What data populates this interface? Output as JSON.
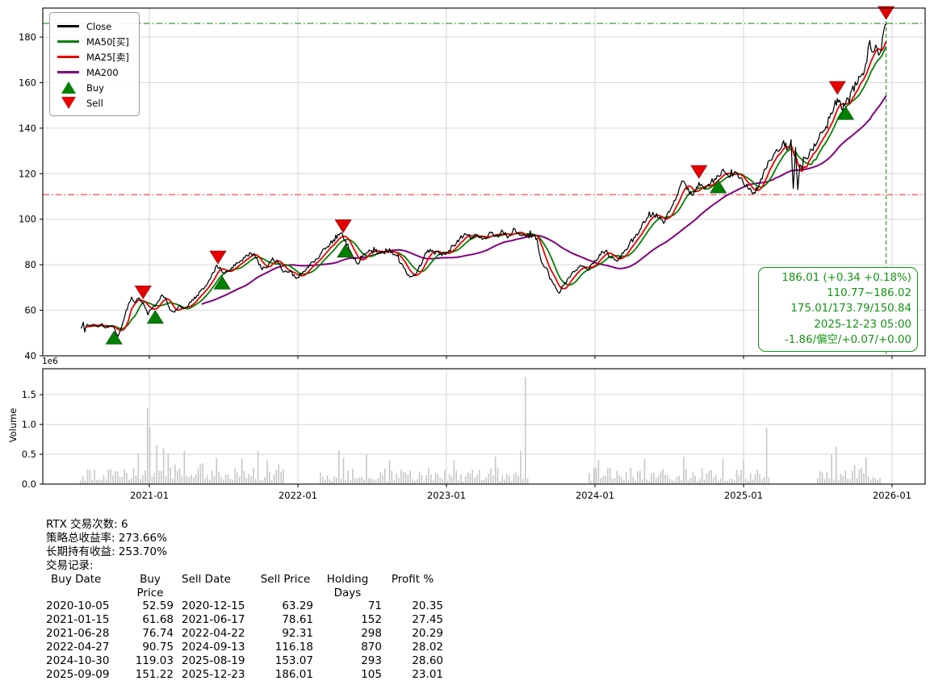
{
  "chart_data": {
    "type": "line",
    "seed": 1337,
    "x_axis": {
      "ticks": [
        2021,
        2022,
        2023,
        2024,
        2025,
        2026
      ],
      "tick_labels": [
        "2021-01",
        "2022-01",
        "2023-01",
        "2024-01",
        "2025-01",
        "2026-01"
      ]
    },
    "price_axis": {
      "ticks": [
        40,
        60,
        80,
        100,
        120,
        140,
        160,
        180
      ],
      "tick_labels": [
        "40",
        "60",
        "80",
        "100",
        "120",
        "140",
        "160",
        "180"
      ],
      "range": [
        40,
        192.8
      ]
    },
    "volume_axis": {
      "ticks": [
        0.0,
        0.5,
        1.0,
        1.5
      ],
      "tick_labels": [
        "0.0",
        "0.5",
        "1.0",
        "1.5"
      ],
      "scale_label": "1e6",
      "ylabel": "Volume",
      "range": [
        0,
        1.93
      ]
    },
    "legend": [
      {
        "label": "Close",
        "color": "#000000",
        "type": "line"
      },
      {
        "label": "MA50[买]",
        "color": "#008000",
        "type": "line"
      },
      {
        "label": "MA25[卖]",
        "color": "#e60000",
        "type": "line"
      },
      {
        "label": "MA200",
        "color": "#800080",
        "type": "line"
      },
      {
        "label": "Buy",
        "color": "#008000",
        "type": "triangle-up"
      },
      {
        "label": "Sell",
        "color": "#e60000",
        "type": "triangle-down"
      }
    ],
    "series": {
      "close": {
        "name": "Close",
        "color": "#000000",
        "anchors": [
          [
            2020.54,
            52.0
          ],
          [
            2020.555,
            54.8
          ],
          [
            2020.565,
            50.5
          ],
          [
            2020.58,
            53.8
          ],
          [
            2020.6,
            53.2
          ],
          [
            2020.625,
            53.8
          ],
          [
            2020.65,
            52.8
          ],
          [
            2020.68,
            54.2
          ],
          [
            2020.7,
            52.4
          ],
          [
            2020.73,
            53.0
          ],
          [
            2020.762,
            52.59
          ],
          [
            2020.79,
            48.6
          ],
          [
            2020.81,
            52.0
          ],
          [
            2020.835,
            57.5
          ],
          [
            2020.86,
            63.0
          ],
          [
            2020.88,
            65.8
          ],
          [
            2020.9,
            63.5
          ],
          [
            2020.93,
            65.5
          ],
          [
            2020.958,
            63.29
          ],
          [
            2020.99,
            58.0
          ],
          [
            2021.01,
            60.5
          ],
          [
            2021.04,
            61.68
          ],
          [
            2021.06,
            64.0
          ],
          [
            2021.085,
            66.8
          ],
          [
            2021.11,
            65.5
          ],
          [
            2021.14,
            60.0
          ],
          [
            2021.17,
            59.2
          ],
          [
            2021.2,
            62.0
          ],
          [
            2021.24,
            61.0
          ],
          [
            2021.28,
            63.5
          ],
          [
            2021.32,
            66.5
          ],
          [
            2021.36,
            69.5
          ],
          [
            2021.4,
            73.0
          ],
          [
            2021.43,
            76.5
          ],
          [
            2021.455,
            79.8
          ],
          [
            2021.462,
            78.61
          ],
          [
            2021.49,
            76.74
          ],
          [
            2021.53,
            77.5
          ],
          [
            2021.57,
            80.0
          ],
          [
            2021.61,
            81.5
          ],
          [
            2021.66,
            84.0
          ],
          [
            2021.7,
            84.8
          ],
          [
            2021.73,
            82.0
          ],
          [
            2021.76,
            77.8
          ],
          [
            2021.8,
            79.5
          ],
          [
            2021.83,
            83.0
          ],
          [
            2021.87,
            80.5
          ],
          [
            2021.91,
            77.0
          ],
          [
            2021.95,
            77.5
          ],
          [
            2021.99,
            74.0
          ],
          [
            2022.03,
            76.5
          ],
          [
            2022.08,
            80.0
          ],
          [
            2022.12,
            82.5
          ],
          [
            2022.16,
            85.5
          ],
          [
            2022.2,
            88.0
          ],
          [
            2022.24,
            91.0
          ],
          [
            2022.285,
            93.8
          ],
          [
            2022.305,
            92.31
          ],
          [
            2022.32,
            90.75
          ],
          [
            2022.36,
            85.0
          ],
          [
            2022.4,
            80.5
          ],
          [
            2022.44,
            84.5
          ],
          [
            2022.48,
            86.5
          ],
          [
            2022.52,
            86.0
          ],
          [
            2022.56,
            85.0
          ],
          [
            2022.6,
            86.5
          ],
          [
            2022.65,
            84.5
          ],
          [
            2022.69,
            80.5
          ],
          [
            2022.73,
            76.5
          ],
          [
            2022.77,
            74.8
          ],
          [
            2022.81,
            78.0
          ],
          [
            2022.85,
            83.5
          ],
          [
            2022.89,
            86.8
          ],
          [
            2022.93,
            86.0
          ],
          [
            2022.97,
            84.0
          ],
          [
            2023.01,
            85.5
          ],
          [
            2023.05,
            88.5
          ],
          [
            2023.09,
            91.5
          ],
          [
            2023.13,
            93.5
          ],
          [
            2023.17,
            92.0
          ],
          [
            2023.21,
            93.2
          ],
          [
            2023.25,
            91.5
          ],
          [
            2023.3,
            94.0
          ],
          [
            2023.34,
            93.0
          ],
          [
            2023.38,
            94.5
          ],
          [
            2023.42,
            92.5
          ],
          [
            2023.46,
            95.8
          ],
          [
            2023.5,
            93.0
          ],
          [
            2023.54,
            92.5
          ],
          [
            2023.58,
            93.0
          ],
          [
            2023.61,
            91.5
          ],
          [
            2023.64,
            81.0
          ],
          [
            2023.68,
            78.0
          ],
          [
            2023.72,
            71.5
          ],
          [
            2023.76,
            67.5
          ],
          [
            2023.79,
            71.0
          ],
          [
            2023.83,
            74.5
          ],
          [
            2023.87,
            77.5
          ],
          [
            2023.91,
            79.5
          ],
          [
            2023.95,
            78.0
          ],
          [
            2023.99,
            80.5
          ],
          [
            2024.03,
            84.5
          ],
          [
            2024.07,
            86.0
          ],
          [
            2024.11,
            83.0
          ],
          [
            2024.15,
            81.5
          ],
          [
            2024.19,
            85.0
          ],
          [
            2024.23,
            89.0
          ],
          [
            2024.27,
            92.0
          ],
          [
            2024.31,
            96.0
          ],
          [
            2024.35,
            100.5
          ],
          [
            2024.39,
            103.0
          ],
          [
            2024.43,
            100.5
          ],
          [
            2024.47,
            99.0
          ],
          [
            2024.51,
            104.5
          ],
          [
            2024.55,
            110.0
          ],
          [
            2024.585,
            116.8
          ],
          [
            2024.62,
            113.0
          ],
          [
            2024.66,
            110.5
          ],
          [
            2024.7,
            116.18
          ],
          [
            2024.74,
            113.5
          ],
          [
            2024.78,
            116.0
          ],
          [
            2024.83,
            119.03
          ],
          [
            2024.87,
            121.0
          ],
          [
            2024.91,
            118.5
          ],
          [
            2024.95,
            120.5
          ],
          [
            2024.99,
            118.0
          ],
          [
            2025.03,
            113.5
          ],
          [
            2025.07,
            111.8
          ],
          [
            2025.11,
            116.0
          ],
          [
            2025.15,
            122.0
          ],
          [
            2025.19,
            126.0
          ],
          [
            2025.23,
            130.0
          ],
          [
            2025.27,
            134.5
          ],
          [
            2025.3,
            131.0
          ],
          [
            2025.32,
            135.0
          ],
          [
            2025.335,
            113.5
          ],
          [
            2025.35,
            131.5
          ],
          [
            2025.365,
            113.0
          ],
          [
            2025.38,
            124.0
          ],
          [
            2025.42,
            127.0
          ],
          [
            2025.46,
            130.5
          ],
          [
            2025.5,
            134.5
          ],
          [
            2025.54,
            139.0
          ],
          [
            2025.58,
            144.5
          ],
          [
            2025.61,
            149.5
          ],
          [
            2025.632,
            153.07
          ],
          [
            2025.66,
            148.5
          ],
          [
            2025.688,
            151.22
          ],
          [
            2025.72,
            155.5
          ],
          [
            2025.76,
            159.0
          ],
          [
            2025.8,
            164.0
          ],
          [
            2025.83,
            169.0
          ],
          [
            2025.85,
            178.5
          ],
          [
            2025.865,
            173.5
          ],
          [
            2025.89,
            176.5
          ],
          [
            2025.91,
            172.0
          ],
          [
            2025.935,
            179.5
          ],
          [
            2025.96,
            186.01
          ]
        ]
      },
      "ma50": {
        "name": "MA50[买]",
        "color": "#008000",
        "window_days": 50
      },
      "ma25": {
        "name": "MA25[卖]",
        "color": "#e60000",
        "window_days": 25
      },
      "ma200": {
        "name": "MA200",
        "color": "#800080",
        "window_days": 200,
        "start_year": 2021.35
      }
    },
    "markers": {
      "buys": [
        [
          2020.762,
          52.59
        ],
        [
          2021.04,
          61.68
        ],
        [
          2021.49,
          76.74
        ],
        [
          2022.32,
          90.75
        ],
        [
          2024.83,
          119.03
        ],
        [
          2025.688,
          151.22
        ]
      ],
      "sells": [
        [
          2020.958,
          63.29
        ],
        [
          2021.462,
          78.61
        ],
        [
          2022.305,
          92.31
        ],
        [
          2024.7,
          116.18
        ],
        [
          2025.632,
          153.07
        ],
        [
          2025.96,
          186.01
        ]
      ]
    },
    "hlines": [
      {
        "y": 186.02,
        "color": "#149414",
        "style": "dashdot"
      },
      {
        "y": 110.77,
        "color": "#ff3333",
        "style": "dashdot"
      }
    ],
    "vlines": [
      {
        "x": 2025.96,
        "color": "#149414",
        "style": "dashed"
      }
    ],
    "volume": {
      "bar_color": "#c7c7c7",
      "segments": [
        {
          "start": 2020.538,
          "end": 2021.908,
          "base": 0.21
        },
        {
          "start": 2022.152,
          "end": 2023.554,
          "base": 0.17
        },
        {
          "start": 2023.962,
          "end": 2025.185,
          "base": 0.17
        },
        {
          "start": 2025.5,
          "end": 2025.93,
          "base": 0.19
        }
      ],
      "spikes": [
        [
          2020.925,
          0.52
        ],
        [
          2020.995,
          1.27
        ],
        [
          2021.005,
          0.95
        ],
        [
          2021.05,
          0.66
        ],
        [
          2021.09,
          0.6
        ],
        [
          2021.13,
          0.52
        ],
        [
          2021.24,
          0.56
        ],
        [
          2021.45,
          0.44
        ],
        [
          2021.62,
          0.42
        ],
        [
          2021.73,
          0.56
        ],
        [
          2021.8,
          0.4
        ],
        [
          2022.27,
          0.56
        ],
        [
          2022.3,
          0.44
        ],
        [
          2022.46,
          0.5
        ],
        [
          2022.62,
          0.4
        ],
        [
          2023.05,
          0.4
        ],
        [
          2023.33,
          0.46
        ],
        [
          2023.5,
          0.56
        ],
        [
          2023.53,
          1.8
        ],
        [
          2024.02,
          0.4
        ],
        [
          2024.33,
          0.42
        ],
        [
          2024.6,
          0.46
        ],
        [
          2024.86,
          0.42
        ],
        [
          2025.0,
          0.4
        ],
        [
          2025.15,
          0.95
        ],
        [
          2025.6,
          0.5
        ],
        [
          2025.625,
          0.63
        ],
        [
          2025.83,
          0.45
        ]
      ]
    }
  },
  "annotation": {
    "color": "#149414",
    "lines": [
      "186.01 (+0.34 +0.18%)",
      "110.77~186.02",
      "175.01/173.79/150.84",
      "2025-12-23 05:00",
      "-1.86/偏空/+0.07/+0.00"
    ]
  },
  "stats": {
    "lines": [
      "RTX 交易次数: 6",
      "策略总收益率: 273.66%",
      "长期持有收益: 253.70%",
      "交易记录:"
    ]
  },
  "trades": {
    "headers": [
      "Buy Date",
      "Buy Price",
      "",
      "Sell Date",
      "Sell Price",
      "Holding Days",
      "Profit %"
    ],
    "rows": [
      [
        "2020-10-05",
        "52.59",
        "",
        "2020-12-15",
        "63.29",
        "71",
        "20.35"
      ],
      [
        "2021-01-15",
        "61.68",
        "",
        "2021-06-17",
        "78.61",
        "152",
        "27.45"
      ],
      [
        "2021-06-28",
        "76.74",
        "",
        "2022-04-22",
        "92.31",
        "298",
        "20.29"
      ],
      [
        "2022-04-27",
        "90.75",
        "",
        "2024-09-13",
        "116.18",
        "870",
        "28.02"
      ],
      [
        "2024-10-30",
        "119.03",
        "",
        "2025-08-19",
        "153.07",
        "293",
        "28.60"
      ],
      [
        "2025-09-09",
        "151.22",
        "",
        "2025-12-23",
        "186.01",
        "105",
        "23.01"
      ]
    ]
  }
}
